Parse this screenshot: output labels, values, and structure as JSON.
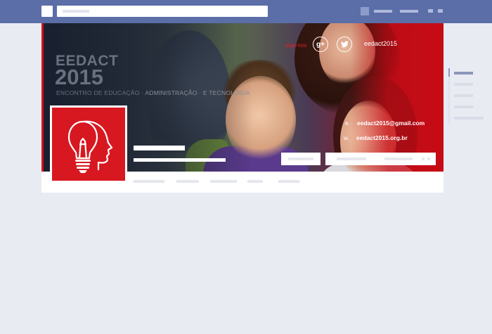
{
  "cover": {
    "brand_title": "EEDACT",
    "brand_year": "2015",
    "brand_tagline_a": "ENCONTRO DE EDUCAÇÃO",
    "brand_tagline_sep1": " · ",
    "brand_tagline_b": "ADMINISTRAÇÃO",
    "brand_tagline_sep2": " · ",
    "brand_tagline_c": "E TECNOLOGIA",
    "siga_label": "siga-nos",
    "gplus_icon_glyph": "g+",
    "twitter_icon_glyph": "🐦",
    "twitter_handle": "eedact2015",
    "email_prefix": "e.",
    "email": "eedact2015@gmail.com",
    "web_prefix": "w.",
    "website": "eedact2015.org.br"
  },
  "icons": {
    "logo": "lightbulb-head-icon",
    "gplus": "google-plus-icon",
    "twitter": "twitter-icon"
  },
  "colors": {
    "topbar": "#5b6ea8",
    "brand_red": "#d81820",
    "page_bg": "#e9ebf3"
  }
}
